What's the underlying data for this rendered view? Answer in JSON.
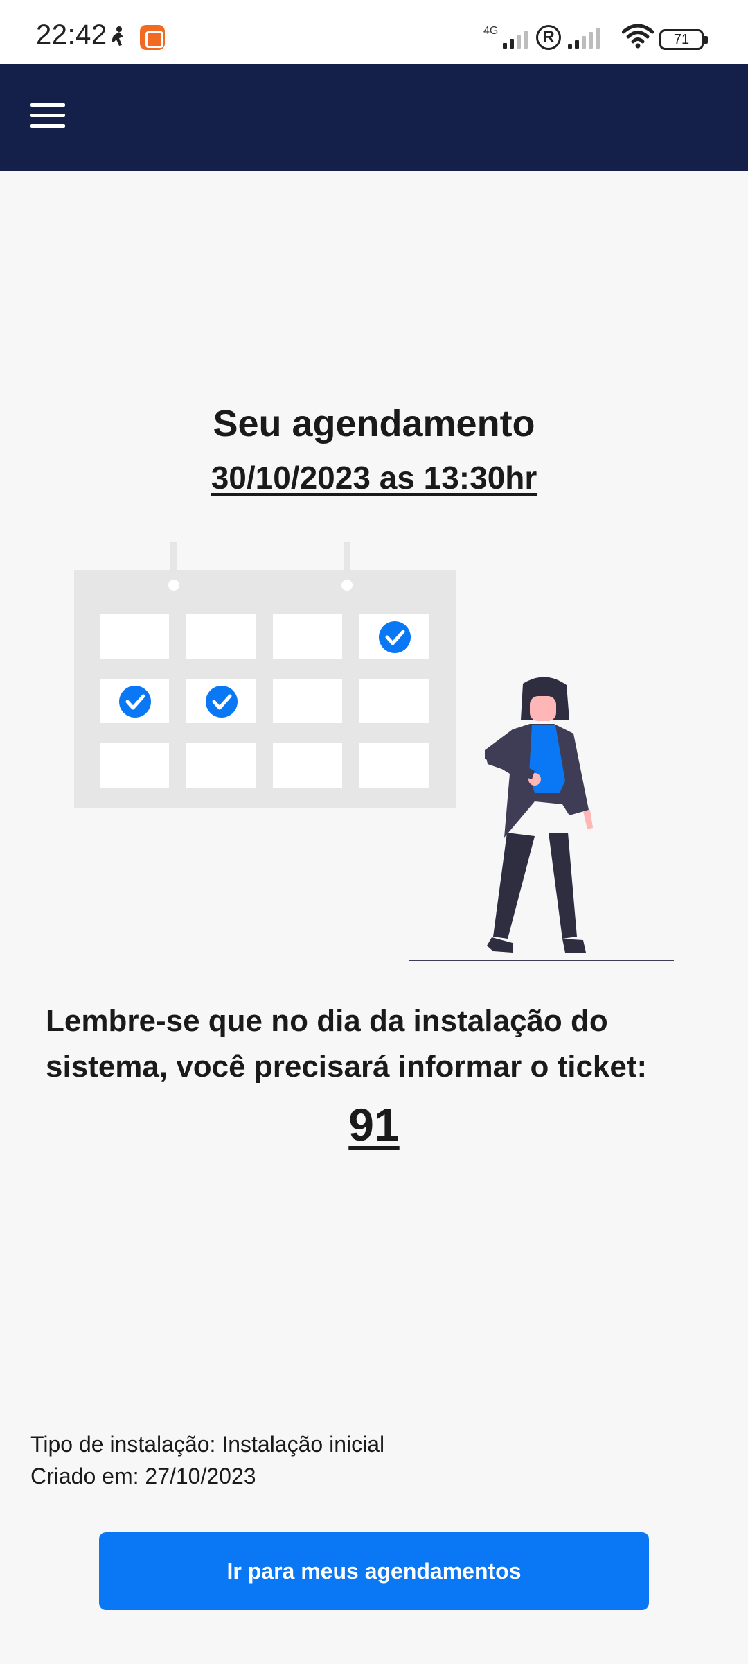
{
  "status_bar": {
    "time": "22:42",
    "network_label": "4G",
    "registered_icon": "R",
    "battery": "71",
    "icons": [
      "person-icon",
      "screen-recorder-icon",
      "signal-icon",
      "registered-icon",
      "signal-icon",
      "wifi-icon",
      "battery-icon"
    ]
  },
  "header": {
    "menu_icon": "hamburger-menu-icon",
    "background_color": "#15204a"
  },
  "main": {
    "title": "Seu agendamento",
    "appointment": "30/10/2023 as 13:30hr",
    "reminder": "Lembre-se que no dia da instalação do sistema, você precisará informar o ticket:",
    "ticket": "91",
    "installation_type": "Tipo de instalação: Instalação inicial",
    "created_at": "Criado em: 27/10/2023"
  },
  "actions": {
    "go_to_appointments": "Ir para meus agendamentos"
  },
  "colors": {
    "accent": "#0a78f5",
    "header": "#15204a",
    "background": "#f7f7f8"
  }
}
